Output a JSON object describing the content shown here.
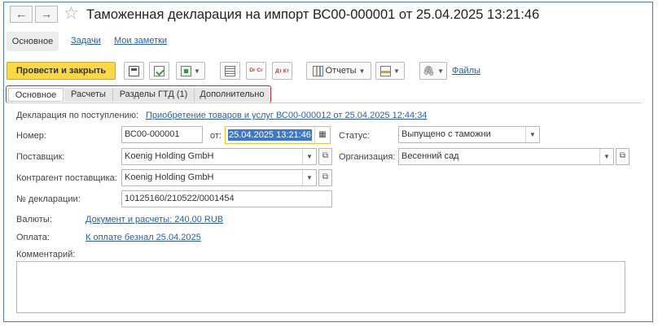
{
  "window": {
    "title": "Таможенная декларация на импорт ВС00-000001 от 25.04.2025 13:21:46",
    "back_glyph": "←",
    "forward_glyph": "→",
    "star_glyph": "☆"
  },
  "sections": [
    {
      "label": "Основное"
    },
    {
      "label": "Задачи"
    },
    {
      "label": "Мои заметки"
    }
  ],
  "toolbar": {
    "post_close_label": "Провести и закрыть",
    "reports_label": "Отчеты",
    "files_label": "Файлы",
    "dt_ct_label": "Дт Кт",
    "dr_cr_label": "Dr Cr"
  },
  "tabs": [
    {
      "label": "Основное",
      "active": true
    },
    {
      "label": "Расчеты",
      "active": false
    },
    {
      "label": "Разделы ГТД (1)",
      "active": false
    },
    {
      "label": "Дополнительно",
      "active": false
    }
  ],
  "form": {
    "basis_label": "Декларация по поступлению:",
    "basis_link": "Приобретение товаров и услуг ВС00-000012 от 25.04.2025 12:44:34",
    "number_label": "Номер:",
    "number_value": "ВС00-000001",
    "date_label": "от:",
    "date_value": "25.04.2025 13:21:46",
    "status_label": "Статус:",
    "status_value": "Выпущено с таможни",
    "supplier_label": "Поставщик:",
    "supplier_value": "Koenig Holding GmbH",
    "org_label": "Организация:",
    "org_value": "Весенний сад",
    "contractor_label": "Контрагент поставщика:",
    "contractor_value": "Koenig Holding GmbH",
    "decl_no_label": "№ декларации:",
    "decl_no_value": "10125160/210522/0001454",
    "currency_label": "Валюты:",
    "currency_link": "Документ и расчеты: 240,00 RUB",
    "payment_label": "Оплата:",
    "payment_link": "К оплате безнал 25.04.2025",
    "comment_label": "Комментарий:",
    "comment_value": ""
  },
  "colors": {
    "primary_button": "#fbd845",
    "link": "#2a5db0",
    "tabs_highlight": "#e02020",
    "date_focus": "#f0c030",
    "selection": "#3c78c8"
  }
}
